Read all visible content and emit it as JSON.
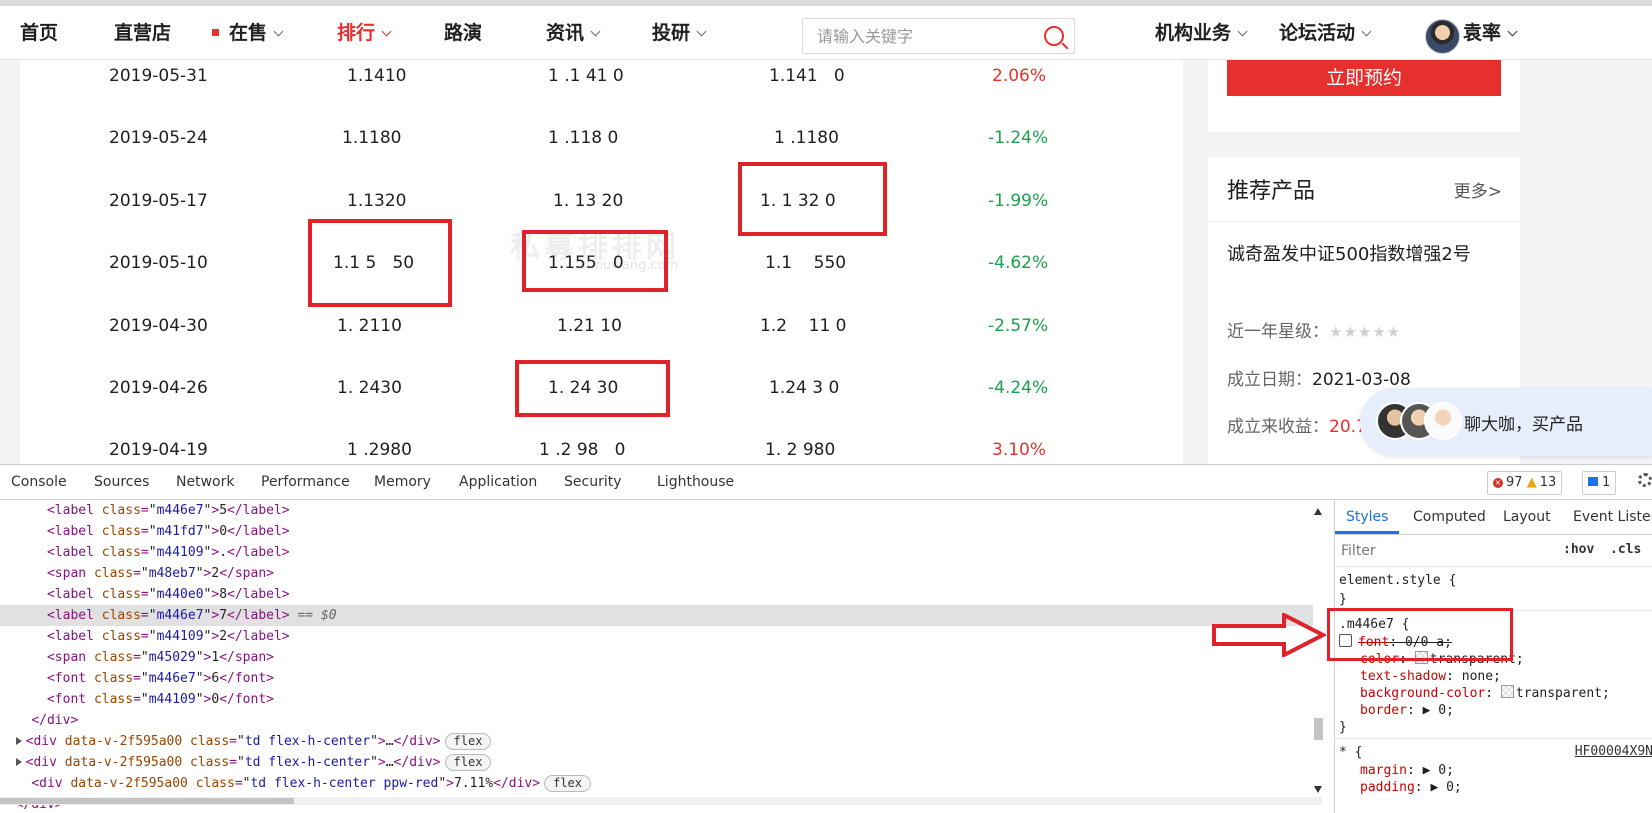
{
  "nav": {
    "items": [
      {
        "label": "首页"
      },
      {
        "label": "直营店"
      },
      {
        "label": "在售"
      },
      {
        "label": "排行"
      },
      {
        "label": "路演"
      },
      {
        "label": "资讯"
      },
      {
        "label": "投研"
      }
    ],
    "search_placeholder": "请输入关键字",
    "right_items": [
      {
        "label": "机构业务"
      },
      {
        "label": "论坛活动"
      }
    ],
    "user_name": "袁率"
  },
  "table": {
    "rows": [
      {
        "date": "2019-05-31",
        "c1": "1.1410",
        "c2": "1 .1 41 0",
        "c3": "1.141   0",
        "change": "2.06%",
        "dir": "pos"
      },
      {
        "date": "2019-05-24",
        "c1": "1.1180",
        "c2": "1 .118 0",
        "c3": "1 .1180",
        "change": "-1.24%",
        "dir": "neg"
      },
      {
        "date": "2019-05-17",
        "c1": "1.1320",
        "c2": "1. 13 20",
        "c3": "1. 1 32 0",
        "change": "-1.99%",
        "dir": "neg"
      },
      {
        "date": "2019-05-10",
        "c1": "1.1 5   50",
        "c2": "1.155   0",
        "c3": "1.1    550",
        "change": "-4.62%",
        "dir": "neg"
      },
      {
        "date": "2019-04-30",
        "c1": "1. 2110",
        "c2": "1.21 10",
        "c3": "1.2    11 0",
        "change": "-2.57%",
        "dir": "neg"
      },
      {
        "date": "2019-04-26",
        "c1": "1. 2430",
        "c2": "1. 24 30",
        "c3": "1.24 3 0",
        "change": "-4.24%",
        "dir": "neg"
      },
      {
        "date": "2019-04-19",
        "c1": "1 .2980",
        "c2": "1 .2 98   0",
        "c3": "1. 2 980",
        "change": "3.10%",
        "dir": "pos"
      }
    ],
    "watermark": "私募排排网",
    "watermark_sub": "simuwang.com"
  },
  "sidebar": {
    "book_button": "立即预约",
    "recommend_title": "推荐产品",
    "more_link": "更多>",
    "product_name": "诚奇盈发中证500指数增强2号",
    "rating_label": "近一年星级：",
    "rating_stars": "★★★★★",
    "founded_label": "成立日期：",
    "founded_value": "2021-03-08",
    "return_label": "成立来收益：",
    "return_value": "20.7"
  },
  "chat": {
    "text": "聊大咖，买产品"
  },
  "devtools": {
    "tabs": [
      "Console",
      "Sources",
      "Network",
      "Performance",
      "Memory",
      "Application",
      "Security",
      "Lighthouse"
    ],
    "errors": "97",
    "warnings": "13",
    "messages": "1",
    "elements": [
      {
        "tag": "label",
        "cls": "m446e7",
        "text": "5"
      },
      {
        "tag": "label",
        "cls": "m41fd7",
        "text": "0"
      },
      {
        "tag": "label",
        "cls": "m44109",
        "text": "."
      },
      {
        "tag": "span",
        "cls": "m48eb7",
        "text": "2"
      },
      {
        "tag": "label",
        "cls": "m440e0",
        "text": "8"
      },
      {
        "tag": "label",
        "cls": "m446e7",
        "text": "7",
        "selected": true,
        "suffix": " == $0"
      },
      {
        "tag": "label",
        "cls": "m44109",
        "text": "2"
      },
      {
        "tag": "span",
        "cls": "m45029",
        "text": "1"
      },
      {
        "tag": "font",
        "cls": "m446e7",
        "text": "6"
      },
      {
        "tag": "font",
        "cls": "m44109",
        "text": "0"
      }
    ],
    "close_div": "</div>",
    "div_rows": [
      {
        "attr": "data-v-2f595a00",
        "cls": "td flex-h-center",
        "inner": "…",
        "pill": "flex"
      },
      {
        "attr": "data-v-2f595a00",
        "cls": "td flex-h-center",
        "inner": "…",
        "pill": "flex"
      },
      {
        "attr": "data-v-2f595a00",
        "cls": "td flex-h-center ppw-red",
        "inner": "7.11%",
        "pill": "flex"
      }
    ],
    "trailing": "</div>",
    "styles": {
      "tabs": [
        "Styles",
        "Computed",
        "Layout",
        "Event Listen"
      ],
      "filter_placeholder": "Filter",
      "hov": ":hov",
      "cls": ".cls",
      "element_style": "element.style {",
      "close_brace": "}",
      "rule_selector": ".m446e7 {",
      "declarations": [
        {
          "prop": "font",
          "value": "0/0 a;",
          "struck": true
        },
        {
          "prop": "color",
          "value": "transparent;",
          "swatch": true
        },
        {
          "prop": "text-shadow",
          "value": "none;"
        },
        {
          "prop": "background-color",
          "value": "transparent;",
          "swatch": true
        },
        {
          "prop": "border",
          "value": "0;",
          "expand": true
        }
      ],
      "universal_selector": "* {",
      "universal_source": "HF00004X9N",
      "universal_decls": [
        {
          "prop": "margin",
          "value": "0;",
          "expand": true
        },
        {
          "prop": "padding",
          "value": "0;",
          "expand": true
        }
      ]
    }
  }
}
